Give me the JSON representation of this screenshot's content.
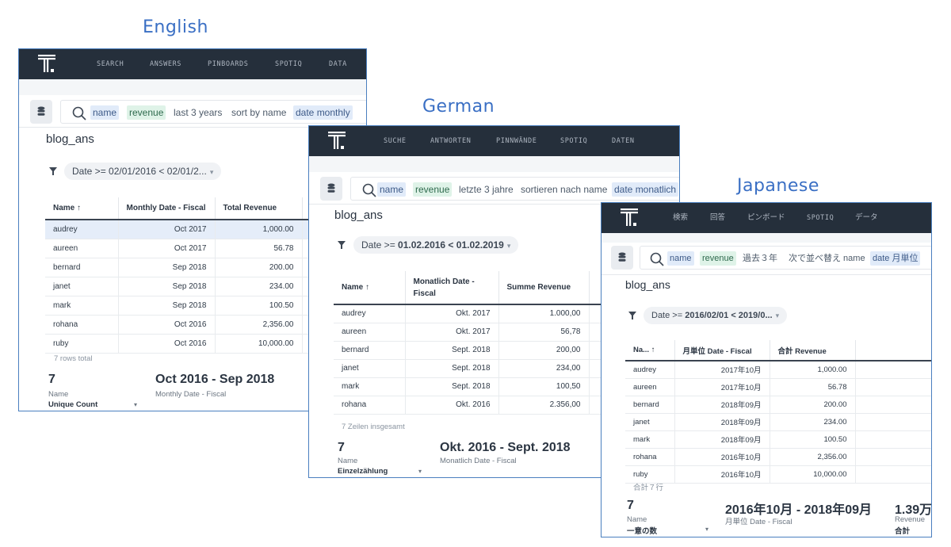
{
  "labels": {
    "english": "English",
    "german": "German",
    "japanese": "Japanese"
  },
  "english": {
    "nav": [
      "SEARCH",
      "ANSWERS",
      "PINBOARDS",
      "SPOTIQ",
      "DATA"
    ],
    "tokens": [
      "name",
      "revenue",
      "last 3 years",
      "sort by name",
      "date monthly"
    ],
    "title": "blog_ans",
    "filter": "Date >= 02/01/2016 < 02/01/2...",
    "columns": [
      "Name ↑",
      "Monthly Date - Fiscal",
      "Total Revenue"
    ],
    "rows": [
      [
        "audrey",
        "Oct 2017",
        "1,000.00"
      ],
      [
        "aureen",
        "Oct 2017",
        "56.78"
      ],
      [
        "bernard",
        "Sep 2018",
        "200.00"
      ],
      [
        "janet",
        "Sep 2018",
        "234.00"
      ],
      [
        "mark",
        "Sep 2018",
        "100.50"
      ],
      [
        "rohana",
        "Oct 2016",
        "2,356.00"
      ],
      [
        "ruby",
        "Oct 2016",
        "10,000.00"
      ]
    ],
    "total": "7 rows total",
    "kpi1_value": "7",
    "kpi1_label": "Name",
    "kpi1_sub": "Unique Count",
    "kpi2_value": "Oct 2016 - Sep 2018",
    "kpi2_label": "Monthly Date - Fiscal"
  },
  "german": {
    "nav": [
      "SUCHE",
      "ANTWORTEN",
      "PINNWÄNDE",
      "SPOTIQ",
      "DATEN"
    ],
    "tokens": [
      "name",
      "revenue",
      "letzte 3 jahre",
      "sortieren nach name",
      "date monatlich"
    ],
    "title": "blog_ans",
    "filter_pre": "Date >= ",
    "filter_bold": "01.02.2016 < 01.02.2019",
    "columns": [
      "Name ↑",
      "Monatlich Date - Fiscal",
      "Summe Revenue"
    ],
    "rows": [
      [
        "audrey",
        "Okt. 2017",
        "1.000,00"
      ],
      [
        "aureen",
        "Okt. 2017",
        "56,78"
      ],
      [
        "bernard",
        "Sept. 2018",
        "200,00"
      ],
      [
        "janet",
        "Sept. 2018",
        "234,00"
      ],
      [
        "mark",
        "Sept. 2018",
        "100,50"
      ],
      [
        "rohana",
        "Okt. 2016",
        "2.356,00"
      ]
    ],
    "total": "7 Zeilen insgesamt",
    "kpi1_value": "7",
    "kpi1_label": "Name",
    "kpi1_sub": "Einzelzählung",
    "kpi2_value": "Okt. 2016 - Sept. 2018",
    "kpi2_label": "Monatlich Date - Fiscal"
  },
  "japanese": {
    "nav": [
      "検索",
      "回答",
      "ピンボード",
      "SPOTIQ",
      "データ"
    ],
    "tokens": [
      "name",
      "revenue",
      "過去３年",
      "次で並べ替え name",
      "date 月単位"
    ],
    "title": "blog_ans",
    "filter_pre": "Date >= ",
    "filter_bold": "2016/02/01 < 2019/0...",
    "columns": [
      "Na... ↑",
      "月単位 Date - Fiscal",
      "合計 Revenue"
    ],
    "rows": [
      [
        "audrey",
        "2017年10月",
        "1,000.00"
      ],
      [
        "aureen",
        "2017年10月",
        "56.78"
      ],
      [
        "bernard",
        "2018年09月",
        "200.00"
      ],
      [
        "janet",
        "2018年09月",
        "234.00"
      ],
      [
        "mark",
        "2018年09月",
        "100.50"
      ],
      [
        "rohana",
        "2016年10月",
        "2,356.00"
      ],
      [
        "ruby",
        "2016年10月",
        "10,000.00"
      ]
    ],
    "total": "合計７行",
    "kpi1_value": "7",
    "kpi1_label": "Name",
    "kpi1_sub": "一意の数",
    "kpi2_value": "2016年10月 - 2018年09月",
    "kpi2_label": "月単位 Date - Fiscal",
    "kpi3_value": "1.39万",
    "kpi3_label": "Revenue",
    "kpi3_sub": "合計"
  },
  "icons": {
    "logo": "thoughtspot-logo",
    "db": "database-icon",
    "search": "search-icon",
    "filter": "filter-icon"
  }
}
